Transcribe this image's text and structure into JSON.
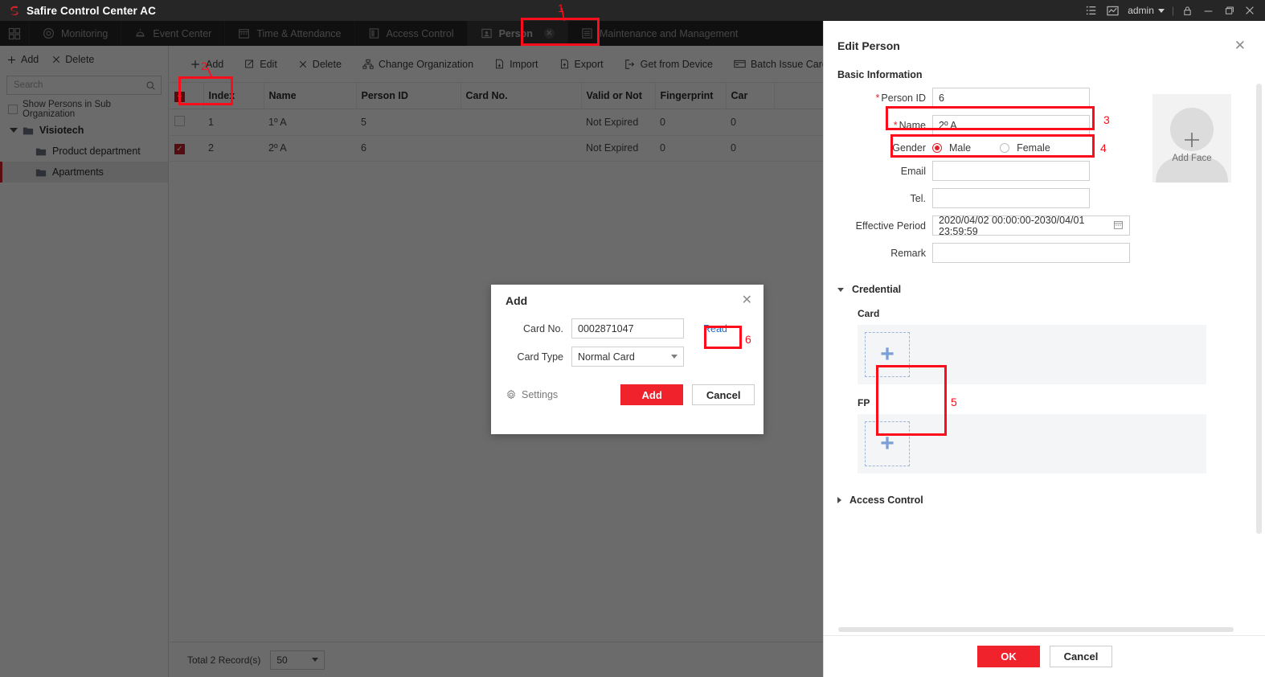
{
  "titlebar": {
    "app_title": "Safire Control Center AC",
    "user": "admin",
    "icons": [
      "list-icon",
      "chart-icon",
      "lock-icon",
      "minimize-icon",
      "maximize-icon",
      "close-icon"
    ]
  },
  "nav": {
    "items": [
      {
        "label": "Monitoring",
        "icon": "monitor-icon",
        "active": false
      },
      {
        "label": "Event Center",
        "icon": "alarm-icon",
        "active": false
      },
      {
        "label": "Time & Attendance",
        "icon": "calendar-icon",
        "active": false
      },
      {
        "label": "Access Control",
        "icon": "door-icon",
        "active": false
      },
      {
        "label": "Person",
        "icon": "person-card-icon",
        "active": true
      },
      {
        "label": "Maintenance and Management",
        "icon": "maintenance-icon",
        "active": false
      }
    ]
  },
  "sidebar": {
    "add_label": "Add",
    "delete_label": "Delete",
    "search_placeholder": "Search",
    "show_sub_org_label": "Show Persons in Sub Organization",
    "tree": [
      {
        "label": "Visiotech",
        "level": 0,
        "selected": false
      },
      {
        "label": "Product department",
        "level": 1,
        "selected": false
      },
      {
        "label": "Apartments",
        "level": 1,
        "selected": true
      }
    ]
  },
  "toolbar": {
    "items": [
      {
        "label": "Add",
        "icon": "plus-icon"
      },
      {
        "label": "Edit",
        "icon": "pencil-square-icon"
      },
      {
        "label": "Delete",
        "icon": "x-icon"
      },
      {
        "label": "Change Organization",
        "icon": "org-tree-icon"
      },
      {
        "label": "Import",
        "icon": "import-icon"
      },
      {
        "label": "Export",
        "icon": "export-icon"
      },
      {
        "label": "Get from Device",
        "icon": "device-arrow-icon"
      },
      {
        "label": "Batch Issue Cards",
        "icon": "card-icon"
      }
    ]
  },
  "table": {
    "columns": [
      "Index",
      "Name",
      "Person ID",
      "Card No.",
      "Valid or Not",
      "Fingerprint",
      "Car"
    ],
    "rows": [
      {
        "checked": false,
        "index": "1",
        "name": "1º A",
        "person_id": "5",
        "card_no": "",
        "valid": "Not Expired",
        "fingerprint": "0",
        "car": "0"
      },
      {
        "checked": true,
        "index": "2",
        "name": "2º A",
        "person_id": "6",
        "card_no": "",
        "valid": "Not Expired",
        "fingerprint": "0",
        "car": "0"
      }
    ],
    "header_checkbox_state": "indeterminate"
  },
  "footer": {
    "total_label": "Total 2 Record(s)",
    "page_size": "50"
  },
  "add_dialog": {
    "title": "Add",
    "card_no_label": "Card No.",
    "card_no_value": "0002871047",
    "card_type_label": "Card Type",
    "card_type_value": "Normal Card",
    "read_label": "Read",
    "settings_label": "Settings",
    "add_label": "Add",
    "cancel_label": "Cancel"
  },
  "edit_person": {
    "title": "Edit Person",
    "basic_info_title": "Basic Information",
    "person_id_label": "Person ID",
    "person_id_value": "6",
    "name_label": "Name",
    "name_value": "2º A",
    "gender_label": "Gender",
    "gender_male": "Male",
    "gender_female": "Female",
    "gender_selected": "Male",
    "email_label": "Email",
    "email_value": "",
    "tel_label": "Tel.",
    "tel_value": "",
    "effective_period_label": "Effective Period",
    "effective_period_value": "2020/04/02 00:00:00-2030/04/01 23:59:59",
    "remark_label": "Remark",
    "remark_value": "",
    "add_face_label": "Add Face",
    "credential_label": "Credential",
    "card_label": "Card",
    "fp_label": "FP",
    "access_control_label": "Access Control",
    "ok_label": "OK",
    "cancel_label": "Cancel"
  },
  "annotations": [
    {
      "number": "1",
      "target": "person-nav-tab"
    },
    {
      "number": "2",
      "target": "toolbar-add-button"
    },
    {
      "number": "3",
      "target": "person-id-field"
    },
    {
      "number": "4",
      "target": "name-field"
    },
    {
      "number": "5",
      "target": "card-add-button"
    },
    {
      "number": "6",
      "target": "read-link"
    }
  ],
  "colors": {
    "accent_red": "#f0232c",
    "annotation_red": "#fc0d1b",
    "titlebar_dark": "#262626",
    "nav_dark": "#333333",
    "link_blue": "#1d6fd0"
  }
}
